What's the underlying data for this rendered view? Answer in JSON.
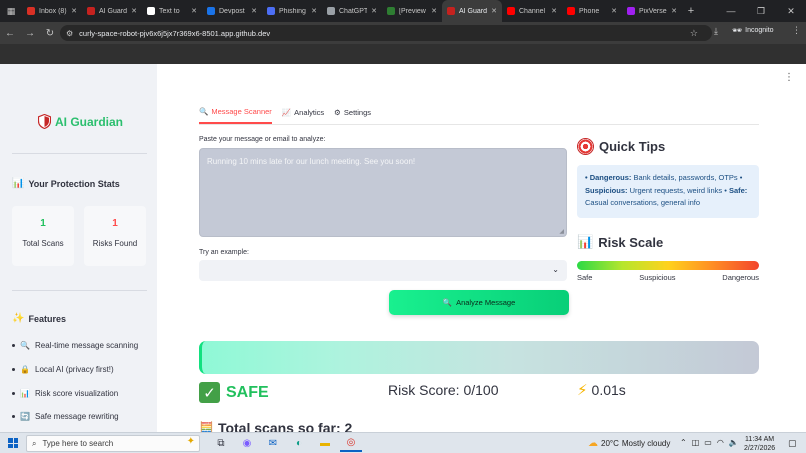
{
  "browser": {
    "tabs": [
      {
        "label": "Inbox (8)",
        "color": "#d93025",
        "active": false
      },
      {
        "label": "AI Guardian",
        "color": "#c5221f",
        "active": false
      },
      {
        "label": "Text to",
        "color": "#ffffff",
        "active": false
      },
      {
        "label": "Devpost",
        "color": "#1a73e8",
        "active": false
      },
      {
        "label": "Phishing",
        "color": "#4c6ef5",
        "active": false
      },
      {
        "label": "ChatGPT",
        "color": "#9aa0a6",
        "active": false
      },
      {
        "label": "[Preview",
        "color": "#2e7d32",
        "active": false
      },
      {
        "label": "AI Guardian",
        "color": "#c5221f",
        "active": true
      },
      {
        "label": "Channel",
        "color": "#ff0000",
        "active": false
      },
      {
        "label": "Phone",
        "color": "#ff0000",
        "active": false
      },
      {
        "label": "PixVerse",
        "color": "#a020f0",
        "active": false
      }
    ],
    "url": "curly-space-robot-pjv6x6j5jx7r369x6-8501.app.github.dev",
    "incognito_label": "Incognito"
  },
  "sidebar": {
    "brand": "AI Guardian",
    "stats_title": "Your Protection Stats",
    "metrics": [
      {
        "value": "1",
        "label": "Total Scans",
        "color": "#21c05d"
      },
      {
        "value": "1",
        "label": "Risks Found",
        "color": "#ff4b4b"
      }
    ],
    "features_title": "Features",
    "features": [
      {
        "icon": "🔍",
        "label": "Real-time message scanning"
      },
      {
        "icon": "🔒",
        "label": "Local AI (privacy first!)"
      },
      {
        "icon": "📊",
        "label": "Risk score visualization"
      },
      {
        "icon": "🔄",
        "label": "Safe message rewriting"
      },
      {
        "icon": "📋",
        "label": "Usage statistics"
      }
    ]
  },
  "main": {
    "tabs": [
      {
        "icon": "🔍",
        "label": "Message Scanner",
        "selected": true
      },
      {
        "icon": "📈",
        "label": "Analytics",
        "selected": false
      },
      {
        "icon": "⚙",
        "label": "Settings",
        "selected": false
      }
    ],
    "paste_label": "Paste your message or email to analyze:",
    "message": "Running 10 mins late for our lunch meeting. See you soon!",
    "example_label": "Try an example:",
    "example_selected": "",
    "analyze_button": "Analyze Message",
    "quick_tips": {
      "title": "Quick Tips",
      "dangerous_label": "• Dangerous:",
      "dangerous_text": " Bank details, passwords, OTPs •",
      "suspicious_label": "Suspicious:",
      "suspicious_text": " Urgent requests, weird links •",
      "safe_label": "Safe:",
      "safe_text": " Casual conversations, general info"
    },
    "risk_scale": {
      "title": "Risk Scale",
      "labels": [
        "Safe",
        "Suspicious",
        "Dangerous"
      ]
    },
    "result": {
      "status": "SAFE",
      "risk_score": "Risk Score: 0/100",
      "time": "0.01s",
      "total_scans": "Total scans so far: 2"
    }
  },
  "taskbar": {
    "search_placeholder": "Type here to search",
    "weather_temp": "20°C",
    "weather_text": "Mostly cloudy",
    "time": "11:34 AM",
    "date": "2/27/2026"
  },
  "colors": {
    "accent": "#ff4b4b",
    "brand": "#2bbf6e",
    "safe": "#21c05d"
  }
}
